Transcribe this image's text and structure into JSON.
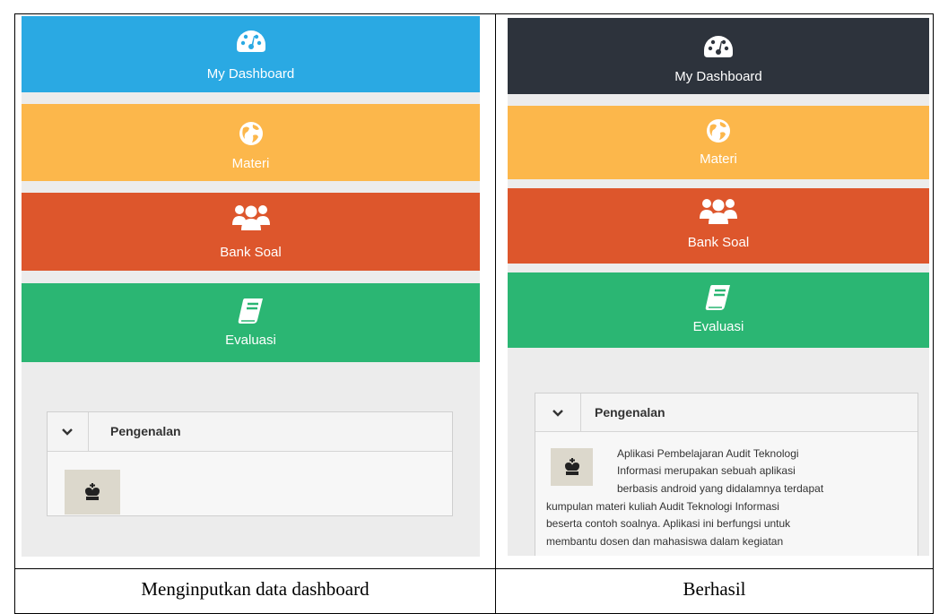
{
  "colors": {
    "dashboard_left": "#2aa9e3",
    "dashboard_right": "#2d333c",
    "materi": "#fcb74b",
    "bank_soal": "#dd562c",
    "evaluasi": "#2bb673",
    "panel_bg": "#ececec"
  },
  "left": {
    "menu": {
      "dashboard": "My Dashboard",
      "materi": "Materi",
      "bank_soal": "Bank Soal",
      "evaluasi": "Evaluasi"
    },
    "card": {
      "title": "Pengenalan"
    },
    "caption": "Menginputkan data dashboard"
  },
  "right": {
    "menu": {
      "dashboard": "My Dashboard",
      "materi": "Materi",
      "bank_soal": "Bank Soal",
      "evaluasi": "Evaluasi"
    },
    "card": {
      "title": "Pengenalan",
      "lines": [
        "Aplikasi Pembelajaran Audit Teknologi",
        "Informasi merupakan sebuah aplikasi",
        "berbasis android yang didalamnya terdapat",
        "kumpulan materi kuliah Audit Teknologi Informasi",
        "beserta contoh soalnya. Aplikasi ini berfungsi untuk",
        "membantu dosen dan mahasiswa dalam kegiatan"
      ]
    },
    "caption": "Berhasil"
  },
  "icons": [
    "dashboard-gauge-icon",
    "globe-icon",
    "users-icon",
    "book-icon",
    "chevron-down-icon",
    "chess-king-icon"
  ]
}
